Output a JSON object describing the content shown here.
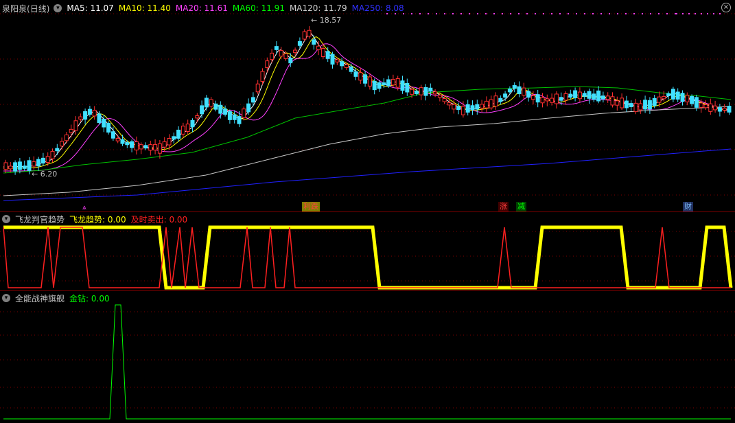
{
  "main": {
    "stock_name": "泉阳泉",
    "period": "(日线)",
    "ma": [
      {
        "label": "MA5: 11.07",
        "color": "#ffffff"
      },
      {
        "label": "MA10: 11.40",
        "color": "#ffff00"
      },
      {
        "label": "MA20: 11.61",
        "color": "#ff40ff"
      },
      {
        "label": "MA60: 11.91",
        "color": "#00ff00"
      },
      {
        "label": "MA120: 11.79",
        "color": "#d0d0d0"
      },
      {
        "label": "MA250: 8.08",
        "color": "#3030ff"
      }
    ],
    "high_label": "18.57",
    "low_label": "6.20",
    "markers": [
      {
        "text": "利跌",
        "bg": "#808000",
        "color": "#ff4040"
      },
      {
        "text": "涨",
        "bg": "#400000",
        "color": "#ff4040"
      },
      {
        "text": "减",
        "bg": "#004000",
        "color": "#00ff00"
      },
      {
        "text": "财",
        "bg": "#203060",
        "color": "#80c0ff"
      }
    ],
    "close_icon": "close-icon"
  },
  "indicator1": {
    "name": "飞龙判官趋势",
    "line1_label": "飞龙趋势: 0.00",
    "line1_color": "#ffff00",
    "line2_label": "及时卖出: 0.00",
    "line2_color": "#ff2020"
  },
  "indicator2": {
    "name": "全能战神旗舰",
    "line1_label": "金钻: 0.00",
    "line1_color": "#00ff00"
  },
  "colors": {
    "up": "#ff3030",
    "down": "#40e0ff",
    "grid": "#800000"
  }
}
